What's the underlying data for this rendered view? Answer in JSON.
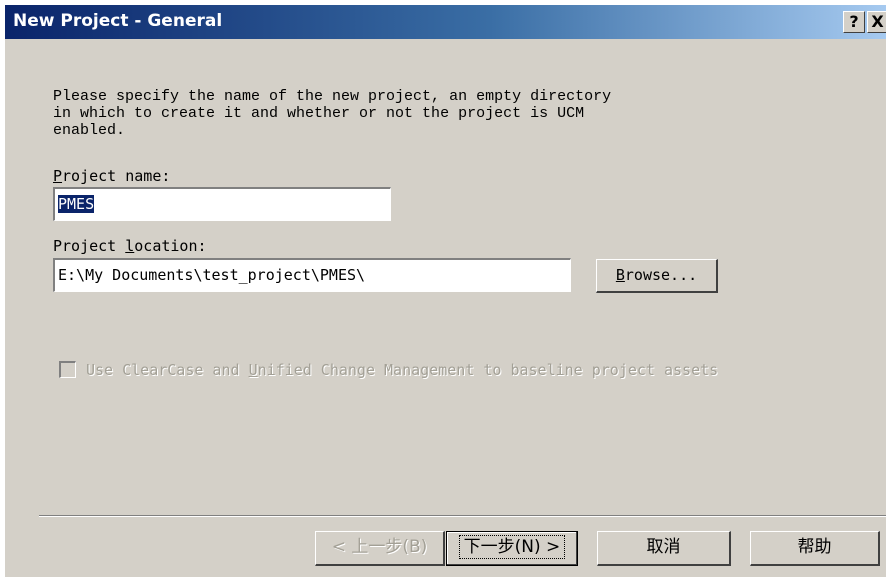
{
  "window": {
    "title": "New Project - General",
    "help_button": "?",
    "close_button": "X"
  },
  "description": "Please specify the name of the new project, an empty directory\nin which to create it and whether or not the project is UCM\nenabled.",
  "project_name": {
    "label_mnemonic": "P",
    "label_rest": "roject name:",
    "value": "PMES"
  },
  "project_location": {
    "label_before": "Project ",
    "label_mnemonic": "l",
    "label_after": "ocation:",
    "value": "E:\\My Documents\\test_project\\PMES\\",
    "browse_mnemonic": "B",
    "browse_rest": "rowse..."
  },
  "ucm_checkbox": {
    "checked": false,
    "enabled": false,
    "label_before": "Use ClearCase and ",
    "label_mnemonic": "U",
    "label_after": "nified Change Management to baseline project assets"
  },
  "wizard_buttons": {
    "back": "< 上一步(B)",
    "next": "下一步(N) >",
    "cancel": "取消",
    "help": "帮助"
  },
  "colors": {
    "dialog_bg": "#d4d0c8",
    "title_start": "#0a246a",
    "title_end": "#a6caf0",
    "selection": "#0a246a",
    "disabled_text": "#a3a096"
  }
}
